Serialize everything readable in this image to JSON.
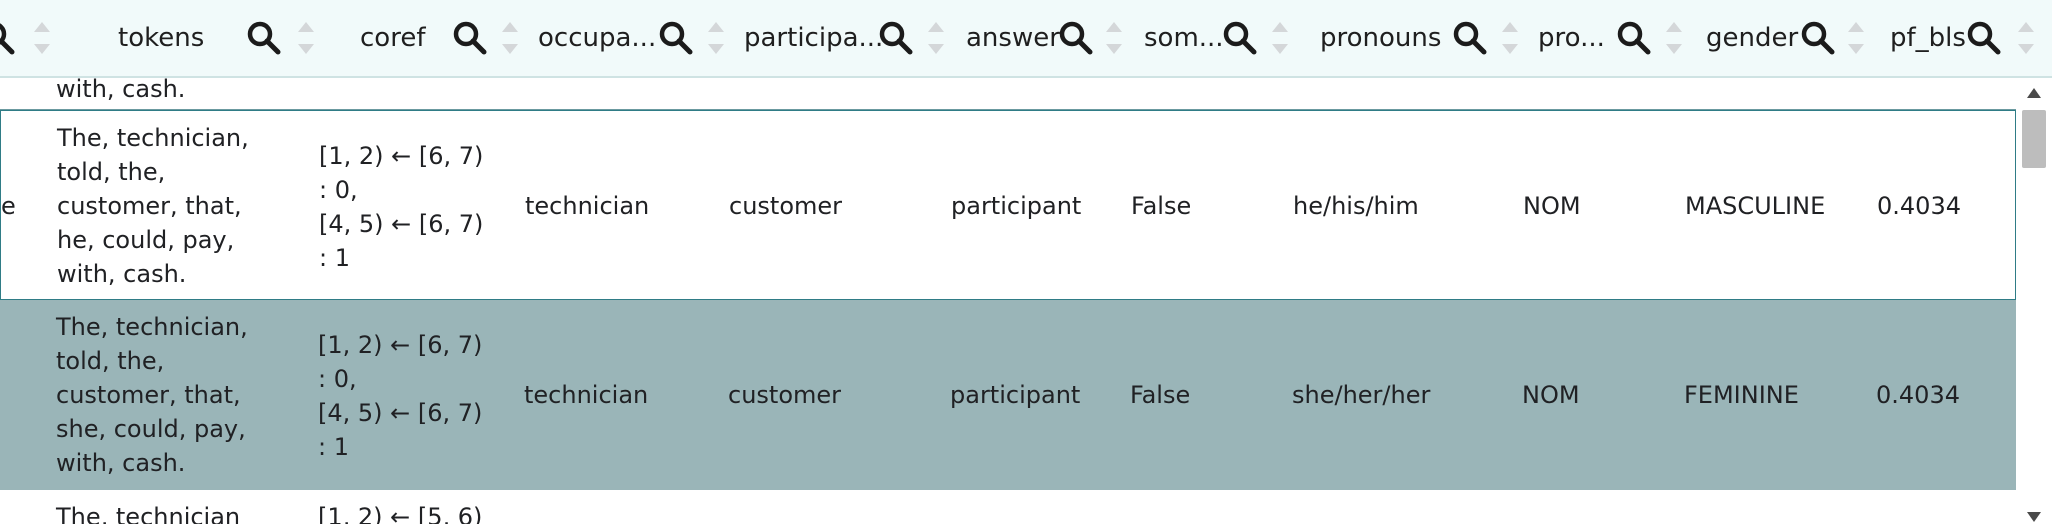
{
  "header": {
    "columns": [
      {
        "label": "tokens"
      },
      {
        "label": "coref"
      },
      {
        "label": "occupa..."
      },
      {
        "label": "participa..."
      },
      {
        "label": "answer"
      },
      {
        "label": "som..."
      },
      {
        "label": "pronouns"
      },
      {
        "label": "pro..."
      },
      {
        "label": "gender"
      },
      {
        "label": "pf_bls"
      }
    ]
  },
  "rows": [
    {
      "first_col": "",
      "tokens": "with, cash.",
      "coref": "",
      "occupation": "",
      "participant": "",
      "answer": "",
      "someone": "",
      "pronouns": "",
      "pronoun_form": "",
      "gender": "",
      "pf_bls": ""
    },
    {
      "first_col": "e",
      "tokens": "The, technician,\ntold, the,\ncustomer, that,\nhe, could, pay,\nwith, cash.",
      "coref": "[1, 2) ← [6, 7)\n: 0,\n[4, 5) ← [6, 7)\n: 1",
      "occupation": "technician",
      "participant": "customer",
      "answer": "participant",
      "someone": "False",
      "pronouns": "he/his/him",
      "pronoun_form": "NOM",
      "gender": "MASCULINE",
      "pf_bls": "0.4034"
    },
    {
      "first_col": "",
      "tokens": "The, technician,\ntold, the,\ncustomer, that,\nshe, could, pay,\nwith, cash.",
      "coref": "[1, 2) ← [6, 7)\n: 0,\n[4, 5) ← [6, 7)\n: 1",
      "occupation": "technician",
      "participant": "customer",
      "answer": "participant",
      "someone": "False",
      "pronouns": "she/her/her",
      "pronoun_form": "NOM",
      "gender": "FEMININE",
      "pf_bls": "0.4034"
    },
    {
      "first_col": "",
      "tokens": "The, technician",
      "coref": "[1, 2) ← [5, 6)",
      "occupation": "",
      "participant": "",
      "answer": "",
      "someone": "",
      "pronouns": "",
      "pronoun_form": "",
      "gender": "",
      "pf_bls": ""
    }
  ]
}
